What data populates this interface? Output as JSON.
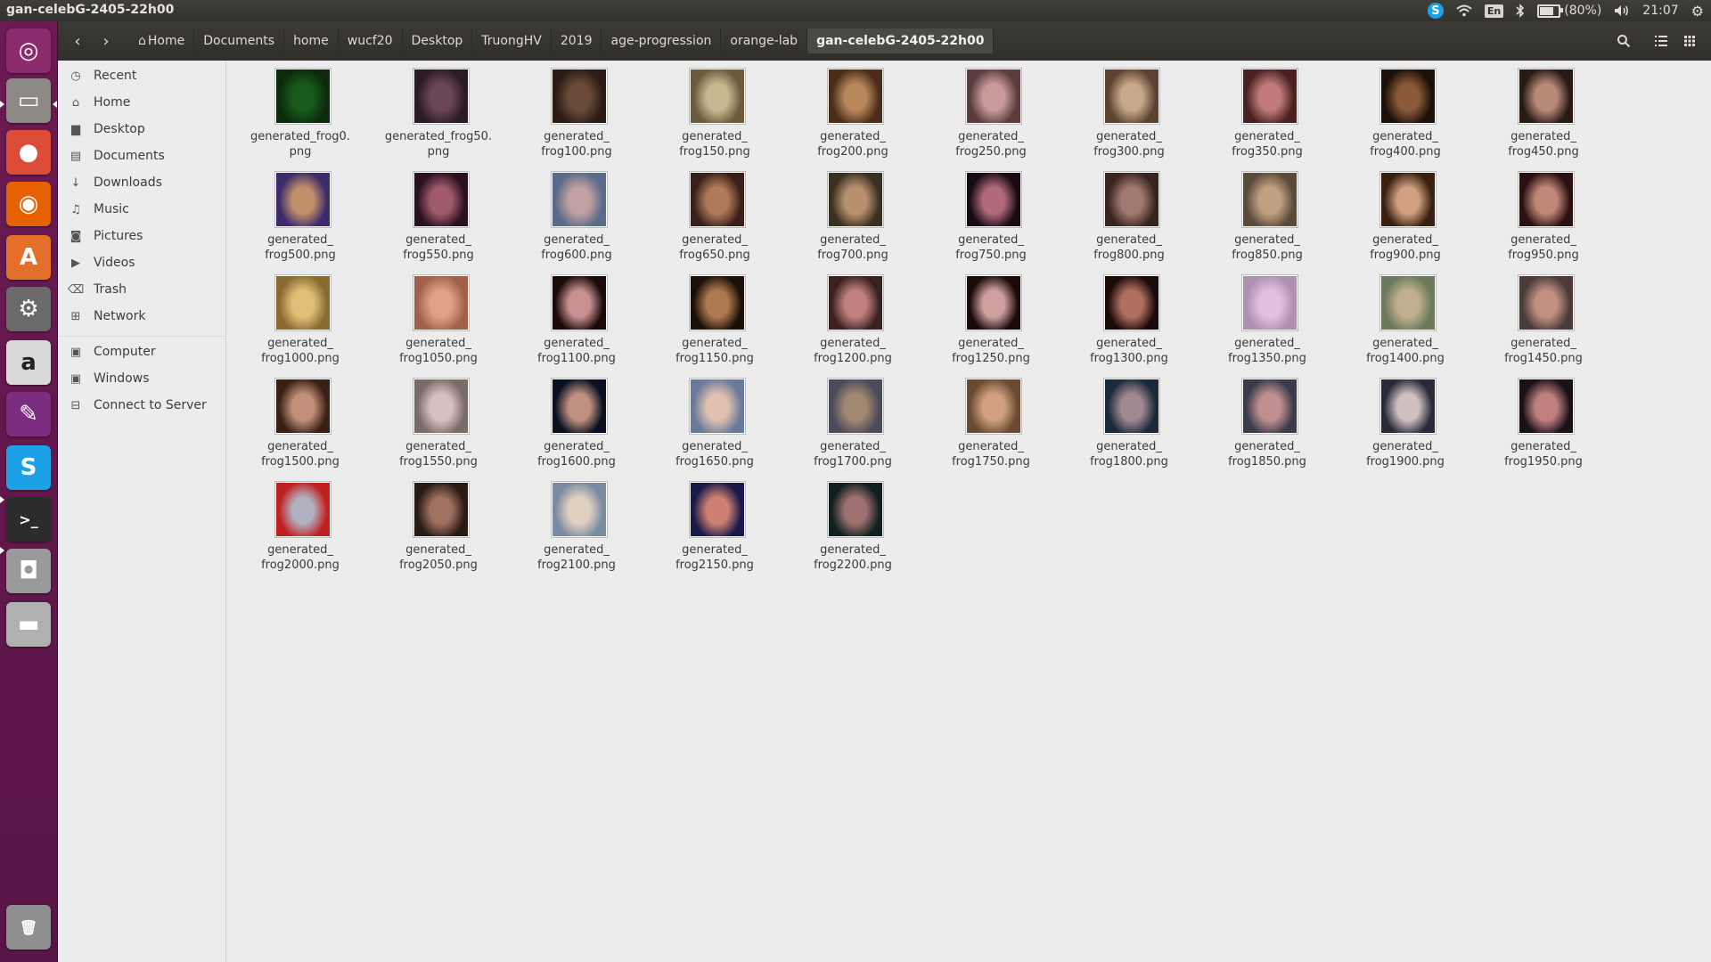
{
  "window": {
    "title": "gan-celebG-2405-22h00"
  },
  "panel": {
    "skype": "S",
    "lang": "En",
    "battery_percent": 80,
    "battery_label": "(80%)",
    "time": "21:07"
  },
  "launcher": {
    "items": [
      {
        "name": "ubuntu-dash-icon",
        "glyph": "◎",
        "color": "#8b2a6d"
      },
      {
        "name": "files-icon",
        "glyph": "▭",
        "color": "#8d8a85"
      },
      {
        "name": "chrome-icon",
        "glyph": "●",
        "color": "#dd4b39"
      },
      {
        "name": "firefox-icon",
        "glyph": "◉",
        "color": "#e66000"
      },
      {
        "name": "software-center-icon",
        "glyph": "A",
        "color": "#e46f2a"
      },
      {
        "name": "system-settings-icon",
        "glyph": "⚙",
        "color": "#6a6a6a"
      },
      {
        "name": "amazon-icon",
        "glyph": "a",
        "color": "#d9d9d9"
      },
      {
        "name": "libreoffice-draw-icon",
        "glyph": "✎",
        "color": "#7b2d7f"
      },
      {
        "name": "skype-icon",
        "glyph": "S",
        "color": "#1ea0e6"
      },
      {
        "name": "terminal-icon",
        "glyph": ">_",
        "color": "#2c2c2c"
      },
      {
        "name": "screenshot-icon",
        "glyph": "◘",
        "color": "#9a9a9a"
      },
      {
        "name": "drive-icon",
        "glyph": "▬",
        "color": "#b0b0b0"
      },
      {
        "name": "trash-icon",
        "glyph": "🗑",
        "color": "#8f8f8f"
      }
    ]
  },
  "toolbar": {
    "back": "‹",
    "forward": "›",
    "breadcrumb": [
      {
        "label": "Home",
        "home": true
      },
      {
        "label": "Documents"
      },
      {
        "label": "home"
      },
      {
        "label": "wucf20"
      },
      {
        "label": "Desktop"
      },
      {
        "label": "TruongHV"
      },
      {
        "label": "2019"
      },
      {
        "label": "age-progression"
      },
      {
        "label": "orange-lab"
      },
      {
        "label": "gan-celebG-2405-22h00",
        "active": true
      }
    ]
  },
  "sidebar": {
    "group1": [
      {
        "label": "Recent",
        "icon": "clock-icon",
        "glyph": "◷"
      },
      {
        "label": "Home",
        "icon": "home-icon",
        "glyph": "⌂"
      },
      {
        "label": "Desktop",
        "icon": "folder-icon",
        "glyph": "▆"
      },
      {
        "label": "Documents",
        "icon": "document-icon",
        "glyph": "▤"
      },
      {
        "label": "Downloads",
        "icon": "download-icon",
        "glyph": "↓"
      },
      {
        "label": "Music",
        "icon": "music-icon",
        "glyph": "♫"
      },
      {
        "label": "Pictures",
        "icon": "camera-icon",
        "glyph": "◙"
      },
      {
        "label": "Videos",
        "icon": "video-icon",
        "glyph": "▶"
      },
      {
        "label": "Trash",
        "icon": "trash-icon",
        "glyph": "⌫"
      },
      {
        "label": "Network",
        "icon": "network-icon",
        "glyph": "⊞"
      }
    ],
    "group2": [
      {
        "label": "Computer",
        "icon": "computer-icon",
        "glyph": "▣"
      },
      {
        "label": "Windows",
        "icon": "drive-icon",
        "glyph": "▣"
      },
      {
        "label": "Connect to Server",
        "icon": "server-icon",
        "glyph": "⊟"
      }
    ]
  },
  "files": [
    {
      "label": "generated_frog0.\npng",
      "c1": "#1a5a1a",
      "c2": "#0c2b0c"
    },
    {
      "label": "generated_frog50.\npng",
      "c1": "#6b4658",
      "c2": "#2c1a24"
    },
    {
      "label": "generated_\nfrog100.png",
      "c1": "#6a4a38",
      "c2": "#2a1c14"
    },
    {
      "label": "generated_\nfrog150.png",
      "c1": "#c8b890",
      "c2": "#6b5a3c"
    },
    {
      "label": "generated_\nfrog200.png",
      "c1": "#b8875c",
      "c2": "#4a2c18"
    },
    {
      "label": "generated_\nfrog250.png",
      "c1": "#c89a9a",
      "c2": "#5a3c3c"
    },
    {
      "label": "generated_\nfrog300.png",
      "c1": "#c8a88a",
      "c2": "#5c4230"
    },
    {
      "label": "generated_\nfrog350.png",
      "c1": "#c07a7a",
      "c2": "#4a2020"
    },
    {
      "label": "generated_\nfrog400.png",
      "c1": "#8a5a3a",
      "c2": "#1c1008"
    },
    {
      "label": "generated_\nfrog450.png",
      "c1": "#b88a78",
      "c2": "#2a1a16"
    },
    {
      "label": "generated_\nfrog500.png",
      "c1": "#c0906a",
      "c2": "#3c2a6a"
    },
    {
      "label": "generated_\nfrog550.png",
      "c1": "#a05a6a",
      "c2": "#2a1020"
    },
    {
      "label": "generated_\nfrog600.png",
      "c1": "#c0a0a0",
      "c2": "#5a6a8a"
    },
    {
      "label": "generated_\nfrog650.png",
      "c1": "#b07a5a",
      "c2": "#3a2018"
    },
    {
      "label": "generated_\nfrog700.png",
      "c1": "#b89070",
      "c2": "#3a3020"
    },
    {
      "label": "generated_\nfrog750.png",
      "c1": "#b06a7a",
      "c2": "#1a0a14"
    },
    {
      "label": "generated_\nfrog800.png",
      "c1": "#a07a70",
      "c2": "#3a2420"
    },
    {
      "label": "generated_\nfrog850.png",
      "c1": "#c0a080",
      "c2": "#5a4a3a"
    },
    {
      "label": "generated_\nfrog900.png",
      "c1": "#d0a080",
      "c2": "#3a2010"
    },
    {
      "label": "generated_\nfrog950.png",
      "c1": "#c08878",
      "c2": "#2a1010"
    },
    {
      "label": "generated_\nfrog1000.png",
      "c1": "#e0c078",
      "c2": "#8a6a30"
    },
    {
      "label": "generated_\nfrog1050.png",
      "c1": "#e0a088",
      "c2": "#a0604a"
    },
    {
      "label": "generated_\nfrog1100.png",
      "c1": "#c89090",
      "c2": "#1a0a0a"
    },
    {
      "label": "generated_\nfrog1150.png",
      "c1": "#b07a50",
      "c2": "#1a1008"
    },
    {
      "label": "generated_\nfrog1200.png",
      "c1": "#c08080",
      "c2": "#3a2020"
    },
    {
      "label": "generated_\nfrog1250.png",
      "c1": "#d0a0a0",
      "c2": "#1a0a0a"
    },
    {
      "label": "generated_\nfrog1300.png",
      "c1": "#b07060",
      "c2": "#1a0a08"
    },
    {
      "label": "generated_\nfrog1350.png",
      "c1": "#e0c0e0",
      "c2": "#b090b0"
    },
    {
      "label": "generated_\nfrog1400.png",
      "c1": "#c0b090",
      "c2": "#6a7a5a"
    },
    {
      "label": "generated_\nfrog1450.png",
      "c1": "#c09080",
      "c2": "#4a3a3a"
    },
    {
      "label": "generated_\nfrog1500.png",
      "c1": "#c0907a",
      "c2": "#3a2014"
    },
    {
      "label": "generated_\nfrog1550.png",
      "c1": "#d8c0c0",
      "c2": "#7a6a6a"
    },
    {
      "label": "generated_\nfrog1600.png",
      "c1": "#c09080",
      "c2": "#0a1020"
    },
    {
      "label": "generated_\nfrog1650.png",
      "c1": "#e0c0b0",
      "c2": "#6a7a9a"
    },
    {
      "label": "generated_\nfrog1700.png",
      "c1": "#a08870",
      "c2": "#4a4a5a"
    },
    {
      "label": "generated_\nfrog1750.png",
      "c1": "#d0a080",
      "c2": "#6a4a30"
    },
    {
      "label": "generated_\nfrog1800.png",
      "c1": "#a08890",
      "c2": "#1a2a3a"
    },
    {
      "label": "generated_\nfrog1850.png",
      "c1": "#c09090",
      "c2": "#3a3a4a"
    },
    {
      "label": "generated_\nfrog1900.png",
      "c1": "#d0c0c0",
      "c2": "#2a2a3a"
    },
    {
      "label": "generated_\nfrog1950.png",
      "c1": "#c08080",
      "c2": "#1a1018"
    },
    {
      "label": "generated_\nfrog2000.png",
      "c1": "#b0b0c0",
      "c2": "#c02020"
    },
    {
      "label": "generated_\nfrog2050.png",
      "c1": "#a07060",
      "c2": "#2a1a14"
    },
    {
      "label": "generated_\nfrog2100.png",
      "c1": "#e0d0c0",
      "c2": "#7a8aa0"
    },
    {
      "label": "generated_\nfrog2150.png",
      "c1": "#d08070",
      "c2": "#1a1a4a"
    },
    {
      "label": "generated_\nfrog2200.png",
      "c1": "#a07070",
      "c2": "#102020"
    }
  ]
}
